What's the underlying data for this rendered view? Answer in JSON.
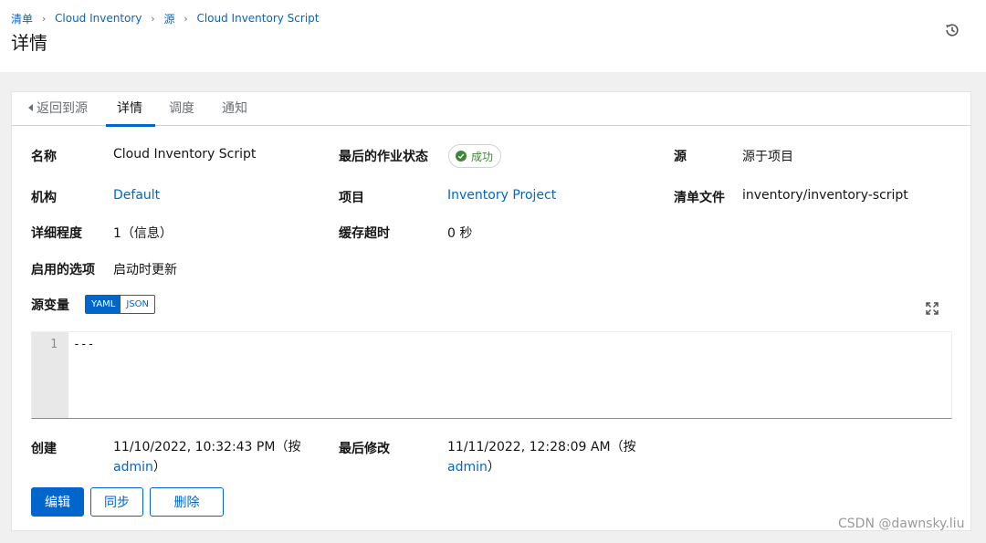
{
  "breadcrumb": {
    "items": [
      "清单",
      "Cloud Inventory",
      "源",
      "Cloud Inventory Script"
    ]
  },
  "page": {
    "title": "详情"
  },
  "tabs": {
    "back": "返回到源",
    "details": "详情",
    "schedules": "调度",
    "notifications": "通知"
  },
  "details": {
    "name_label": "名称",
    "name_value": "Cloud Inventory Script",
    "last_job_status_label": "最后的作业状态",
    "last_job_status_value": "成功",
    "source_label": "源",
    "source_value": "源于项目",
    "organization_label": "机构",
    "organization_value": "Default",
    "project_label": "项目",
    "project_value": "Inventory Project",
    "inventory_file_label": "清单文件",
    "inventory_file_value": "inventory/inventory-script",
    "verbosity_label": "详细程度",
    "verbosity_value": "1（信息）",
    "cache_timeout_label": "缓存超时",
    "cache_timeout_value": "0 秒",
    "enabled_options_label": "启用的选项",
    "enabled_options_value": "启动时更新",
    "source_vars_label": "源变量",
    "created_label": "创建",
    "created_value": "11/10/2022, 10:32:43 PM（按",
    "created_by": "admin",
    "created_close": "）",
    "modified_label": "最后修改",
    "modified_value": "11/11/2022, 12:28:09 AM（按",
    "modified_by": "admin",
    "modified_close": "）"
  },
  "editor": {
    "modes": [
      "YAML",
      "JSON"
    ],
    "selected_mode": "YAML",
    "line_number": "1",
    "content": "---"
  },
  "actions": {
    "edit": "编辑",
    "sync": "同步",
    "delete": "删除"
  },
  "watermark": "CSDN @dawnsky.liu",
  "colors": {
    "link": "#0066cc",
    "success": "#3e8635",
    "background": "#f0f0f0"
  }
}
